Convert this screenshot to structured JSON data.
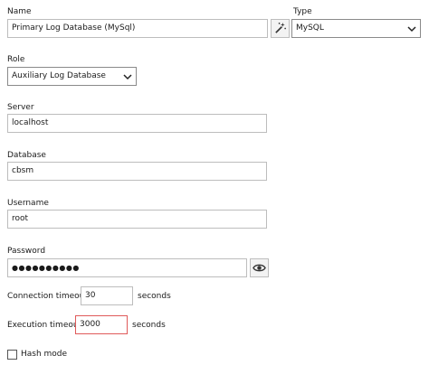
{
  "name": {
    "label": "Name",
    "value": "Primary Log Database (MySql)"
  },
  "type": {
    "label": "Type",
    "value": "MySQL"
  },
  "role": {
    "label": "Role",
    "value": "Auxiliary Log Database"
  },
  "server": {
    "label": "Server",
    "value": "localhost"
  },
  "database": {
    "label": "Database",
    "value": "cbsm"
  },
  "username": {
    "label": "Username",
    "value": "root"
  },
  "password": {
    "label": "Password",
    "value": "●●●●●●●●●●"
  },
  "connection_timeout": {
    "label": "Connection timeout",
    "value": "30",
    "unit": "seconds"
  },
  "execution_timeout": {
    "label": "Execution timeout",
    "value": "3000",
    "unit": "seconds"
  },
  "hash_mode": {
    "label": "Hash mode",
    "checked": false
  },
  "icons": {
    "name_generate": "magic-wand-icon",
    "password_reveal": "eye-icon"
  },
  "colors": {
    "error_border": "#e05a5a"
  }
}
